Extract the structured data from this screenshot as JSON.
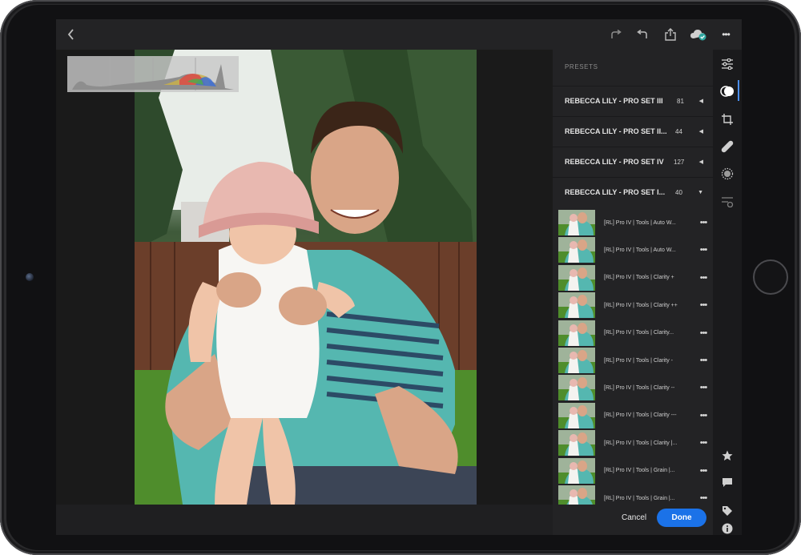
{
  "presets_panel": {
    "title": "PRESETS",
    "groups": [
      {
        "name": "REBECCA LILY - PRO SET III",
        "count": "81",
        "state": "collapsed"
      },
      {
        "name": "REBECCA LILY - PRO SET II...",
        "count": "44",
        "state": "collapsed"
      },
      {
        "name": "REBECCA LILY - PRO SET IV",
        "count": "127",
        "state": "collapsed"
      },
      {
        "name": "REBECCA LILY - PRO SET I...",
        "count": "40",
        "state": "expanded"
      }
    ],
    "presets": [
      {
        "label": "[RL] Pro IV | Tools | Auto W..."
      },
      {
        "label": "[RL] Pro IV | Tools | Auto W..."
      },
      {
        "label": "[RL] Pro IV | Tools | Clarity +"
      },
      {
        "label": "[RL] Pro IV | Tools | Clarity ++"
      },
      {
        "label": "[RL] Pro IV | Tools | Clarity..."
      },
      {
        "label": "[RL] Pro IV | Tools | Clarity -"
      },
      {
        "label": "[RL] Pro IV | Tools | Clarity --"
      },
      {
        "label": "[RL] Pro IV | Tools | Clarity ---"
      },
      {
        "label": "[RL] Pro IV | Tools | Clarity |..."
      },
      {
        "label": "[RL] Pro IV | Tools | Grain |..."
      },
      {
        "label": "[RL] Pro IV | Tools | Grain |..."
      }
    ],
    "more_glyph": "•••"
  },
  "footer": {
    "cancel_label": "Cancel",
    "done_label": "Done"
  },
  "topbar": {
    "icons": [
      "back-icon",
      "redo-icon",
      "undo-icon",
      "share-icon",
      "cloud-synced-icon",
      "more-icon"
    ],
    "more_glyph": "•••"
  },
  "toolrail": {
    "icons": [
      "adjust-sliders-icon",
      "presets-icon",
      "crop-icon",
      "healing-icon",
      "selective-icon",
      "versions-icon",
      "star-icon",
      "comment-icon",
      "tag-icon",
      "info-icon"
    ],
    "active": "presets-icon"
  },
  "colors": {
    "accent": "#1b72e8",
    "active_indicator": "#4a8ef0"
  }
}
